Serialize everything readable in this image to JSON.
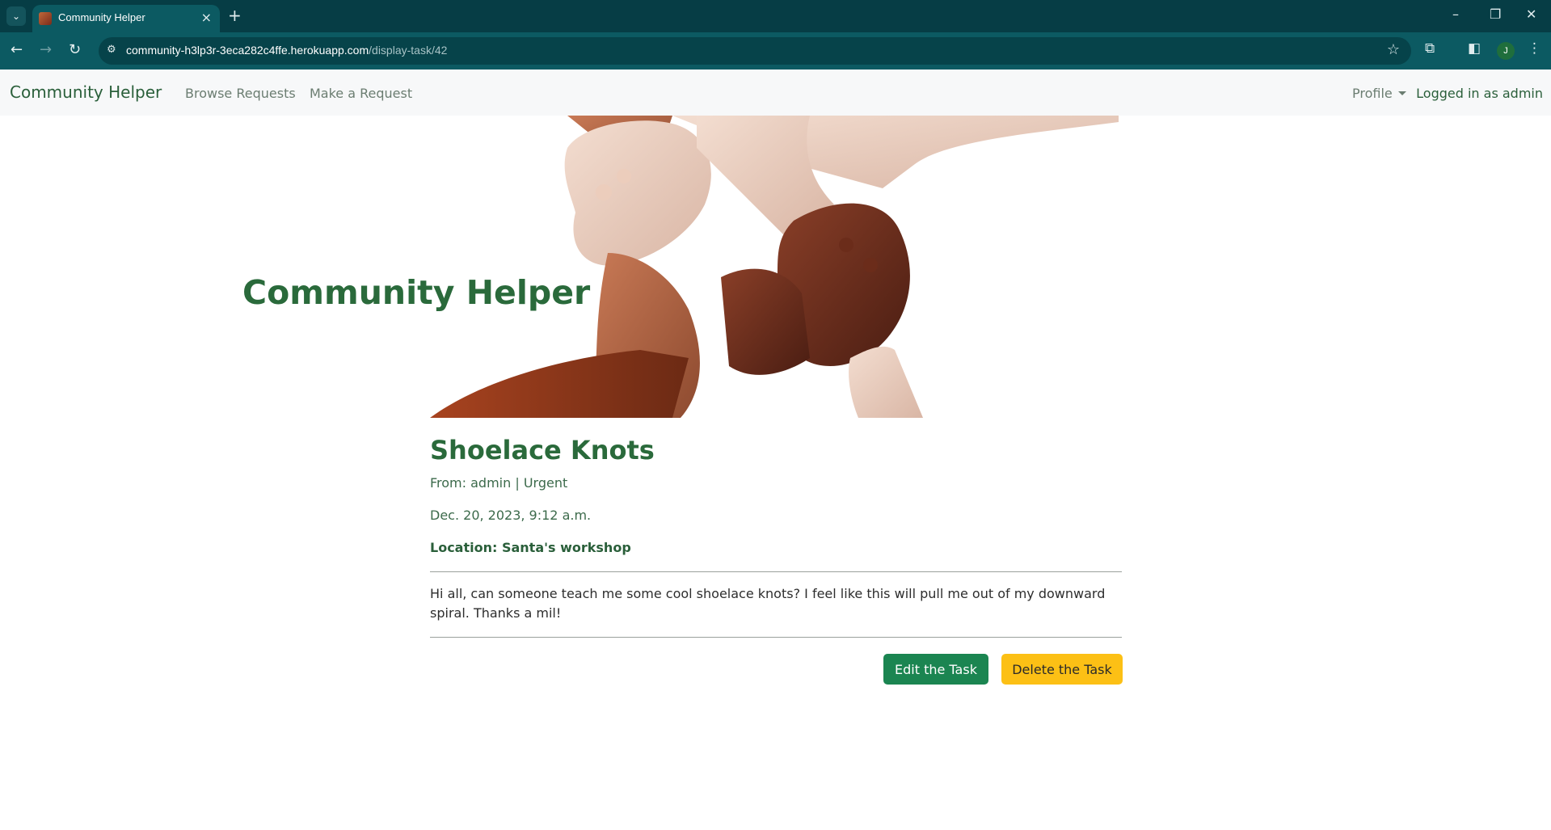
{
  "browser": {
    "tab_title": "Community Helper",
    "url_host": "community-h3lp3r-3eca282c4ffe.herokuapp.com",
    "url_path": "/display-task/42",
    "profile_initial": "J"
  },
  "navbar": {
    "brand": "Community Helper",
    "links": [
      "Browse Requests",
      "Make a Request"
    ],
    "profile_label": "Profile",
    "status": "Logged in as admin"
  },
  "hero": {
    "title": "Community Helper"
  },
  "task": {
    "title": "Shoelace Knots",
    "from_line": "From: admin | Urgent",
    "date": "Dec. 20, 2023, 9:12 a.m.",
    "location": "Location: Santa's workshop",
    "body": "Hi all, can someone teach me some cool shoelace knots? I feel like this will pull me out of my downward spiral. Thanks a mil!",
    "edit_label": "Edit the Task",
    "delete_label": "Delete the Task"
  },
  "colors": {
    "brand_green": "#2a6a3b",
    "edit_button": "#1b8551",
    "delete_button": "#fcc015",
    "browser_frame": "#063d45"
  }
}
